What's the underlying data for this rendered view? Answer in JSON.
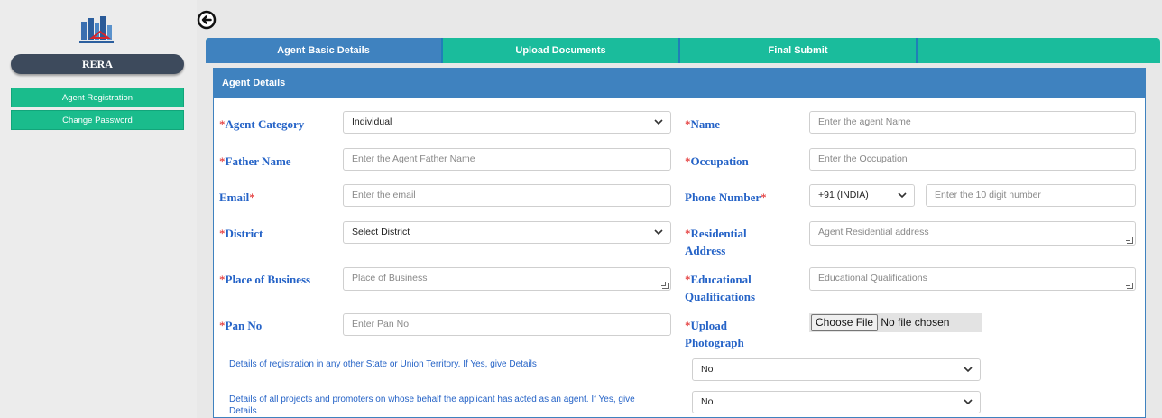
{
  "sidebar": {
    "brand": "RERA",
    "items": [
      {
        "label": "Agent Registration"
      },
      {
        "label": "Change Password"
      }
    ]
  },
  "tabs": [
    {
      "label": "Agent Basic Details",
      "active": true
    },
    {
      "label": "Upload Documents",
      "active": false
    },
    {
      "label": "Final Submit",
      "active": false
    }
  ],
  "panel": {
    "title": "Agent Details"
  },
  "form": {
    "agent_category": {
      "label": "Agent Category",
      "value": "Individual"
    },
    "name": {
      "label": "Name",
      "placeholder": "Enter the agent Name"
    },
    "father_name": {
      "label": "Father Name",
      "placeholder": "Enter the Agent Father Name"
    },
    "occupation": {
      "label": "Occupation",
      "placeholder": "Enter the Occupation"
    },
    "email": {
      "label": "Email",
      "placeholder": "Enter the email"
    },
    "phone": {
      "label": "Phone Number",
      "code": "+91 (INDIA)",
      "placeholder": "Enter the 10 digit number"
    },
    "district": {
      "label": "District",
      "value": "Select District"
    },
    "residential_address": {
      "label_line1": "Residential",
      "label_line2": "Address",
      "placeholder": "Agent Residential address"
    },
    "place_of_business": {
      "label": "Place of Business",
      "placeholder": "Place of Business"
    },
    "educational_qualifications": {
      "label_line1": "Educational",
      "label_line2": "Qualifications",
      "placeholder": "Educational Qualifications"
    },
    "pan_no": {
      "label": "Pan No",
      "placeholder": "Enter Pan No"
    },
    "upload_photograph": {
      "label_line1": "Upload",
      "label_line2": "Photograph",
      "button": "Choose File",
      "status": "No file chosen"
    },
    "other_registration": {
      "question": "Details of registration in any other State or Union Territory. If Yes, give Details",
      "value": "No"
    },
    "other_projects": {
      "question_line1": "Details of all projects and promoters on whose behalf the applicant has acted as an agent. If Yes, give",
      "question_line2": "Details",
      "value": "No"
    }
  },
  "required_mark": "*",
  "colors": {
    "accent_teal": "#1abc9c",
    "accent_blue": "#3f82bf",
    "label_blue": "#2563c7",
    "required_red": "#e02020",
    "brand_dark": "#3d4a5c"
  },
  "icons": [
    "building-logo-icon",
    "back-arrow-icon",
    "chevron-down-icon"
  ]
}
